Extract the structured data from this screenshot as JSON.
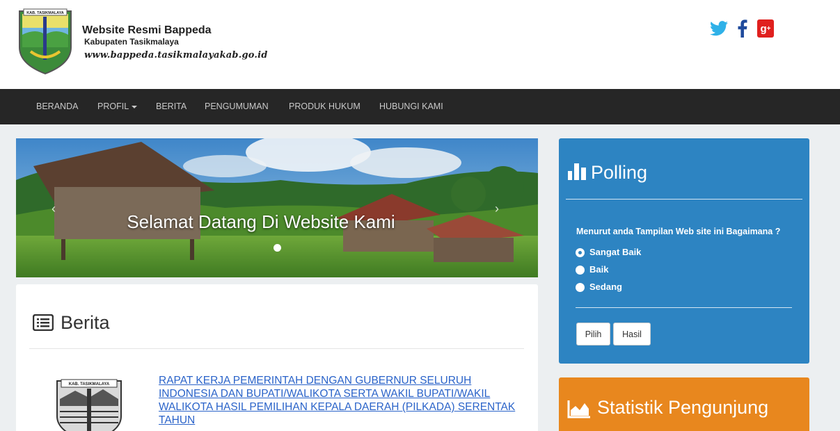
{
  "header": {
    "site_title": "Website Resmi Bappeda",
    "site_subtitle": "Kabupaten Tasikmalaya",
    "site_url": "www.bappeda.tasikmalayakab.go.id",
    "logo_label": "KAB. TASIKMALAYA",
    "social": [
      {
        "icon": "twitter-icon",
        "color": "#2fb1e8"
      },
      {
        "icon": "facebook-icon",
        "color": "#1f4a9c"
      },
      {
        "icon": "google-plus-icon",
        "color": "#e0201e"
      }
    ]
  },
  "nav": {
    "items": [
      "BERANDA",
      "PROFIL",
      "BERITA",
      "PENGUMUMAN",
      "PRODUK HUKUM",
      "HUBUNGI KAMI"
    ]
  },
  "slider": {
    "caption": "Selamat Datang Di Website Kami",
    "prev_glyph": "‹",
    "next_glyph": "›"
  },
  "berita": {
    "title": "Berita",
    "news": [
      {
        "thumb_label": "KAB. TASIKMALAYA",
        "title": "RAPAT KERJA PEMERINTAH DENGAN GUBERNUR SELURUH INDONESIA DAN BUPATI/WALIKOTA SERTA WAKIL BUPATI/WAKIL WALIKOTA HASIL PEMILIHAN KEPALA DAERAH (PILKADA) SERENTAK TAHUN"
      }
    ]
  },
  "polling": {
    "title": "Polling",
    "question": "Menurut anda Tampilan Web site ini Bagaimana ?",
    "options": [
      "Sangat Baik",
      "Baik",
      "Sedang"
    ],
    "selected": "Sangat Baik",
    "buttons": {
      "vote": "Pilih",
      "result": "Hasil"
    },
    "color": "#2d84c2"
  },
  "statistik": {
    "title": "Statistik Pengunjung",
    "color": "#e8871e"
  }
}
